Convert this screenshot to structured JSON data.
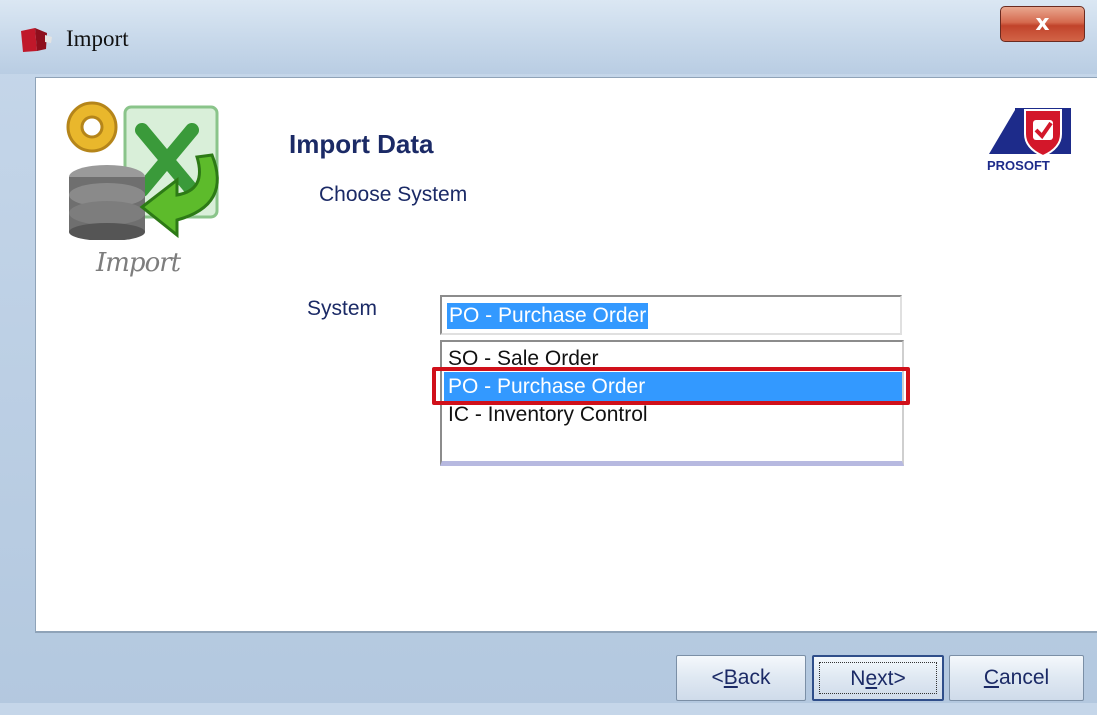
{
  "window": {
    "title": "Import",
    "close_label": "x"
  },
  "logo": {
    "caption": "Import",
    "brand": "PROSOFT"
  },
  "header": {
    "title": "Import Data",
    "subtitle": "Choose System"
  },
  "form": {
    "system_label": "System",
    "system_value": "PO - Purchase Order",
    "options": [
      "SO - Sale Order",
      "PO - Purchase Order",
      "IC - Inventory Control"
    ],
    "selected_index": 1
  },
  "buttons": {
    "back": {
      "mnemonic": "B",
      "prefix": "<",
      "rest": "ack"
    },
    "next": {
      "prefix": "N",
      "mnemonic": "e",
      "rest": "xt>"
    },
    "cancel": {
      "mnemonic": "C",
      "rest": "ancel"
    }
  },
  "colors": {
    "selection": "#3399ff",
    "highlight_border": "#d0101a",
    "text_navy": "#1b2a66"
  },
  "icons": {
    "app": "import-app-icon",
    "close": "close-icon",
    "import_logo": "import-database-excel-icon",
    "brand_logo": "prosoft-logo"
  }
}
